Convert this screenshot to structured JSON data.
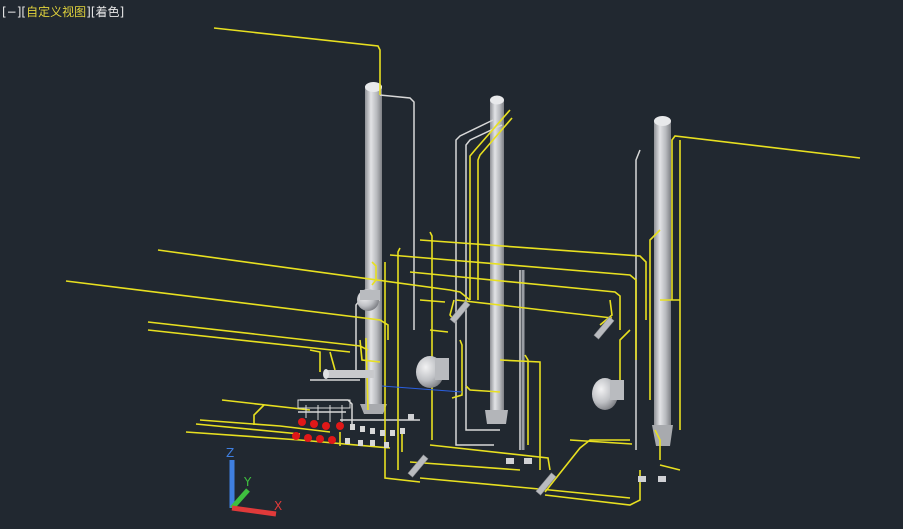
{
  "viewport": {
    "label_minus": "[−]",
    "label_view_open": "[",
    "label_view": "自定义视图",
    "label_view_close": "]",
    "label_style_open": "[",
    "label_style": "着色",
    "label_style_close": "]"
  },
  "ucs": {
    "z": "Z",
    "y": "Y",
    "x": "X"
  },
  "colors": {
    "background": "#212830",
    "pipe_yellow": "#e8e020",
    "pipe_white": "#d8d8d8",
    "vessel": "#c8c9cc",
    "valve_red": "#e01818",
    "axis_x": "#e03a3a",
    "axis_y": "#3fbf3f",
    "axis_z": "#3f7fe0"
  }
}
